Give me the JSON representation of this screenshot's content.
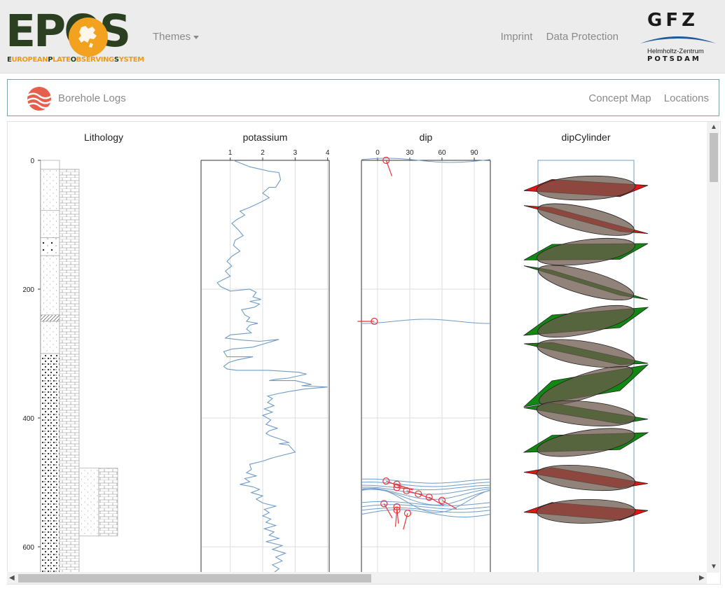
{
  "header": {
    "logo_text": "EPOS",
    "logo_subtitle_parts": [
      "E",
      "UROPEAN",
      "P",
      "LATE",
      "O",
      "BSERVING",
      "S",
      "YSTEM"
    ],
    "themes_label": "Themes",
    "links": [
      "Imprint",
      "Data Protection"
    ],
    "gfz_title": "GFZ",
    "gfz_sub1": "Helmholtz-Zentrum",
    "gfz_sub2": "POTSDAM"
  },
  "subnav": {
    "title": "Borehole Logs",
    "links": [
      "Concept Map",
      "Locations"
    ]
  },
  "colors": {
    "line": "#6f9cc8",
    "grid": "#dddddd",
    "dip_marker": "#e8353a",
    "cyl_red": "#ee1111",
    "cyl_green": "#118811",
    "cyl_inner": "#6e5a4e",
    "nav_border": "#7aa6a8"
  },
  "chart_data": [
    {
      "type": "lithology",
      "title": "Lithology",
      "ylim": [
        0,
        640
      ],
      "yticks": [
        0,
        200,
        400,
        600
      ],
      "layers": [
        {
          "top": 0,
          "bottom": 14,
          "pattern": "blank"
        },
        {
          "top": 14,
          "bottom": 78,
          "pattern": "sand"
        },
        {
          "top": 78,
          "bottom": 120,
          "pattern": "sand"
        },
        {
          "top": 120,
          "bottom": 148,
          "pattern": "gravel"
        },
        {
          "top": 148,
          "bottom": 240,
          "pattern": "sand"
        },
        {
          "top": 240,
          "bottom": 250,
          "pattern": "hatch"
        },
        {
          "top": 250,
          "bottom": 300,
          "pattern": "sand"
        },
        {
          "top": 300,
          "bottom": 640,
          "pattern": "conglomerate"
        }
      ],
      "side_column": [
        {
          "top": 14,
          "bottom": 640,
          "pattern": "limestone"
        }
      ],
      "third_column": [
        {
          "top": 478,
          "bottom": 583,
          "pattern": "sand_limestone"
        }
      ]
    },
    {
      "type": "line",
      "title": "potassium",
      "xlim": [
        0.1,
        4.05
      ],
      "xticks": [
        1,
        2,
        3,
        4
      ],
      "ylim": [
        0,
        640
      ],
      "series": [
        {
          "values": [
            [
              1.1,
              0
            ],
            [
              1.6,
              10
            ],
            [
              2.2,
              17
            ],
            [
              2.5,
              19
            ],
            [
              2.55,
              30
            ],
            [
              2.4,
              42
            ],
            [
              2.2,
              42
            ],
            [
              2.0,
              51
            ],
            [
              2.2,
              58
            ],
            [
              1.9,
              66
            ],
            [
              1.6,
              73
            ],
            [
              1.3,
              79
            ],
            [
              1.45,
              85
            ],
            [
              1.2,
              92
            ],
            [
              1.05,
              98
            ],
            [
              1.25,
              108
            ],
            [
              1.4,
              117
            ],
            [
              1.15,
              124
            ],
            [
              1.1,
              132
            ],
            [
              1.3,
              141
            ],
            [
              1.05,
              149
            ],
            [
              0.9,
              157
            ],
            [
              1.05,
              164
            ],
            [
              0.85,
              172
            ],
            [
              1.0,
              180
            ],
            [
              0.75,
              186
            ],
            [
              0.6,
              190
            ],
            [
              0.7,
              196
            ],
            [
              1.0,
              203
            ],
            [
              1.6,
              200
            ],
            [
              1.8,
              205
            ],
            [
              1.7,
              212
            ],
            [
              1.95,
              216
            ],
            [
              1.6,
              219
            ],
            [
              1.9,
              223
            ],
            [
              1.75,
              228
            ],
            [
              1.35,
              232
            ],
            [
              1.45,
              240
            ],
            [
              1.6,
              244
            ],
            [
              1.5,
              250
            ],
            [
              1.85,
              253
            ],
            [
              1.6,
              256
            ],
            [
              1.5,
              262
            ],
            [
              1.65,
              268
            ],
            [
              1.0,
              271
            ],
            [
              0.85,
              276
            ],
            [
              1.35,
              279
            ],
            [
              1.9,
              281
            ],
            [
              2.5,
              278
            ],
            [
              1.7,
              290
            ],
            [
              1.05,
              293
            ],
            [
              0.8,
              297
            ],
            [
              0.9,
              305
            ],
            [
              1.7,
              305
            ],
            [
              1.2,
              310
            ],
            [
              0.95,
              314
            ],
            [
              0.8,
              320
            ],
            [
              0.9,
              324
            ],
            [
              1.2,
              326
            ],
            [
              2.2,
              326
            ],
            [
              3.1,
              329
            ],
            [
              3.35,
              332
            ],
            [
              2.8,
              338
            ],
            [
              2.4,
              340
            ],
            [
              2.2,
              342
            ],
            [
              3.0,
              342
            ],
            [
              3.5,
              348
            ],
            [
              3.2,
              350
            ],
            [
              4.0,
              352
            ],
            [
              3.3,
              355
            ],
            [
              2.8,
              359
            ],
            [
              2.5,
              362
            ],
            [
              2.15,
              366
            ],
            [
              2.3,
              370
            ],
            [
              2.15,
              376
            ],
            [
              2.35,
              381
            ],
            [
              2.05,
              386
            ],
            [
              2.3,
              391
            ],
            [
              2.0,
              396
            ],
            [
              2.25,
              403
            ],
            [
              2.1,
              410
            ],
            [
              2.45,
              416
            ],
            [
              2.2,
              420
            ],
            [
              2.1,
              424
            ],
            [
              2.25,
              428
            ],
            [
              2.55,
              433
            ],
            [
              2.8,
              438
            ],
            [
              2.5,
              440
            ],
            [
              2.8,
              442
            ],
            [
              3.0,
              453
            ],
            [
              2.6,
              458
            ],
            [
              2.3,
              462
            ],
            [
              2.0,
              467
            ],
            [
              1.6,
              472
            ],
            [
              1.65,
              480
            ],
            [
              1.5,
              485
            ],
            [
              1.8,
              490
            ],
            [
              1.45,
              494
            ],
            [
              1.6,
              499
            ],
            [
              1.3,
              503
            ],
            [
              1.7,
              507
            ],
            [
              1.9,
              511
            ],
            [
              1.65,
              516
            ],
            [
              2.0,
              521
            ],
            [
              1.8,
              526
            ],
            [
              2.0,
              532
            ],
            [
              2.4,
              537
            ],
            [
              2.05,
              542
            ],
            [
              2.2,
              547
            ],
            [
              2.0,
              552
            ],
            [
              2.25,
              557
            ],
            [
              2.1,
              562
            ],
            [
              2.4,
              567
            ],
            [
              2.05,
              572
            ],
            [
              2.35,
              577
            ],
            [
              2.2,
              582
            ],
            [
              2.5,
              587
            ],
            [
              2.1,
              592
            ],
            [
              2.6,
              598
            ],
            [
              2.3,
              604
            ],
            [
              2.7,
              610
            ],
            [
              2.4,
              616
            ],
            [
              2.6,
              622
            ],
            [
              2.3,
              628
            ],
            [
              2.5,
              634
            ],
            [
              2.35,
              640
            ]
          ]
        }
      ]
    },
    {
      "type": "scatter",
      "title": "dip",
      "xlim": [
        -15,
        105
      ],
      "xticks": [
        0,
        30,
        60,
        90
      ],
      "ylim": [
        0,
        640
      ],
      "points": [
        {
          "depth": 0,
          "dip": 8,
          "azimuth": 160
        },
        {
          "depth": 250,
          "dip": -3,
          "azimuth": 270
        },
        {
          "depth": 498,
          "dip": 8,
          "azimuth": 110
        },
        {
          "depth": 503,
          "dip": 18,
          "azimuth": 110
        },
        {
          "depth": 508,
          "dip": 18,
          "azimuth": 95
        },
        {
          "depth": 513,
          "dip": 27,
          "azimuth": 105
        },
        {
          "depth": 518,
          "dip": 38,
          "azimuth": 110
        },
        {
          "depth": 523,
          "dip": 48,
          "azimuth": 120
        },
        {
          "depth": 528,
          "dip": 60,
          "azimuth": 120
        },
        {
          "depth": 533,
          "dip": 6,
          "azimuth": 150
        },
        {
          "depth": 538,
          "dip": 18,
          "azimuth": 175
        },
        {
          "depth": 543,
          "dip": 18,
          "azimuth": 185
        },
        {
          "depth": 548,
          "dip": 28,
          "azimuth": 195
        }
      ]
    },
    {
      "type": "dipCylinder",
      "title": "dipCylinder",
      "ylim": [
        0,
        640
      ],
      "planes": [
        {
          "depth": 43,
          "dip": 15,
          "color": "red"
        },
        {
          "depth": 92,
          "dip": 55,
          "color": "red"
        },
        {
          "depth": 142,
          "dip": 40,
          "color": "green"
        },
        {
          "depth": 190,
          "dip": 60,
          "color": "green"
        },
        {
          "depth": 250,
          "dip": 55,
          "color": "green"
        },
        {
          "depth": 300,
          "dip": 45,
          "color": "green"
        },
        {
          "depth": 350,
          "dip": 65,
          "color": "green"
        },
        {
          "depth": 393,
          "dip": 30,
          "color": "green"
        },
        {
          "depth": 438,
          "dip": 45,
          "color": "green"
        },
        {
          "depth": 493,
          "dip": 30,
          "color": "red"
        },
        {
          "depth": 545,
          "dip": 5,
          "color": "red"
        }
      ]
    }
  ]
}
